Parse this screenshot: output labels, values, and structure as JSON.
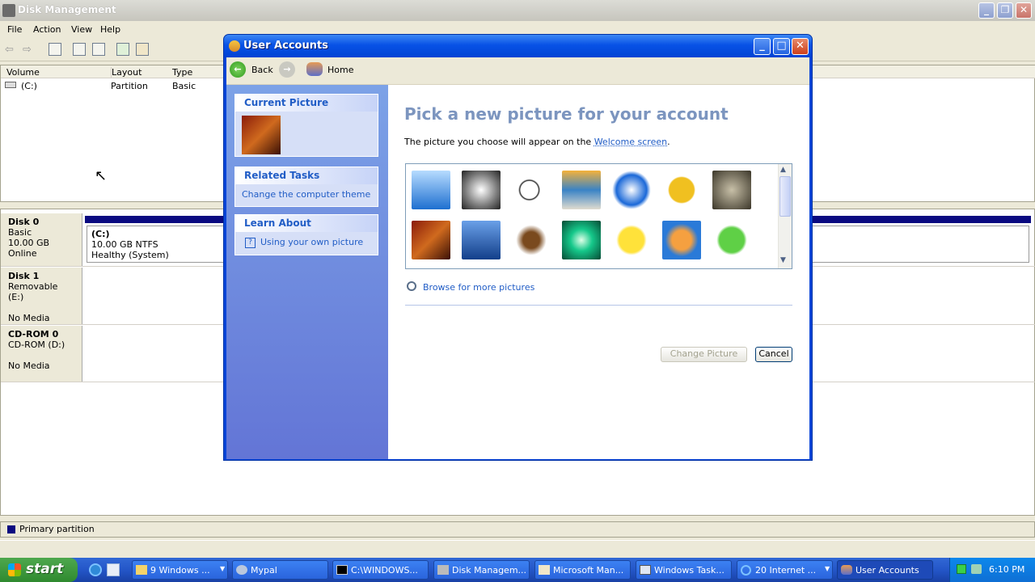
{
  "dm": {
    "title": "Disk Management",
    "menu": [
      "File",
      "Action",
      "View",
      "Help"
    ],
    "columns": [
      "Volume",
      "Layout",
      "Type"
    ],
    "volume_row": {
      "volume": "(C:)",
      "layout": "Partition",
      "type": "Basic"
    },
    "disks": [
      {
        "name": "Disk 0",
        "line1": "Basic",
        "line2": "10.00 GB",
        "line3": "Online",
        "part_name": "(C:)",
        "part_size": "10.00 GB NTFS",
        "part_status": "Healthy (System)"
      },
      {
        "name": "Disk 1",
        "line1": "Removable (E:)",
        "line2": "",
        "line3": "No Media"
      },
      {
        "name": "CD-ROM 0",
        "line1": "CD-ROM (D:)",
        "line2": "",
        "line3": "No Media"
      }
    ],
    "legend": "Primary partition",
    "legend_color": "#0a0a80"
  },
  "ua": {
    "title": "User Accounts",
    "back": "Back",
    "home": "Home",
    "current_picture": "Current Picture",
    "related_tasks": "Related Tasks",
    "related_link": "Change the computer theme",
    "learn_about": "Learn About",
    "learn_link": "Using your own picture",
    "heading": "Pick a new picture for your account",
    "desc_pre": "The picture you choose will appear on the ",
    "desc_link": "Welcome screen",
    "desc_post": ".",
    "pictures": [
      "airplane",
      "astronaut",
      "soccer ball",
      "beach chairs",
      "butterfly",
      "car",
      "cat",
      "chess",
      "dirt bike",
      "dog",
      "drip",
      "duck",
      "fish",
      "frog"
    ],
    "browse": "Browse for more pictures",
    "change_btn": "Change Picture",
    "cancel_btn": "Cancel"
  },
  "taskbar": {
    "start": "start",
    "items": [
      "9 Windows ...",
      "Mypal",
      "C:\\WINDOWS...",
      "Disk Managem...",
      "Microsoft Man...",
      "Windows Task...",
      "20 Internet ...",
      "User Accounts"
    ],
    "clock": "6:10 PM"
  }
}
